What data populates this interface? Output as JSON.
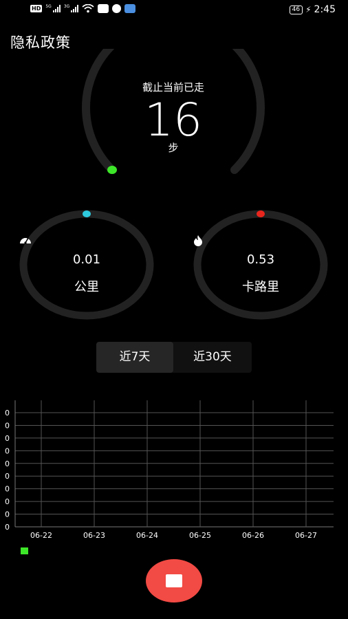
{
  "status_bar": {
    "hd_label": "HD",
    "net_label_1": "5G",
    "net_label_2": "3G",
    "battery_level": "46",
    "time": "2:45"
  },
  "page": {
    "title": "隐私政策"
  },
  "steps": {
    "caption": "截止当前已走",
    "value": "16",
    "unit": "步",
    "progress_fraction": 0.0,
    "indicator_color": "#3ee629"
  },
  "distance": {
    "icon": "speedometer-icon",
    "value": "0.01",
    "unit": "公里",
    "indicator_color": "#2ec9dd"
  },
  "calories": {
    "icon": "flame-icon",
    "value": "0.53",
    "unit": "卡路里",
    "indicator_color": "#e8261d"
  },
  "range_tabs": [
    {
      "label": "近7天",
      "active": true
    },
    {
      "label": "近30天",
      "active": false
    }
  ],
  "chart_data": {
    "type": "bar",
    "categories": [
      "06-22",
      "06-23",
      "06-24",
      "06-25",
      "06-26",
      "06-27"
    ],
    "series": [
      {
        "values": [
          0,
          0,
          0,
          0,
          0,
          0
        ],
        "color": "#3ee629"
      }
    ],
    "y_tick_labels": [
      "0",
      "0",
      "0",
      "0",
      "0",
      "0",
      "0",
      "0",
      "0",
      "0"
    ],
    "grid": true,
    "legend": "bottom-left"
  },
  "colors": {
    "background": "#000000",
    "ring_track": "#222222",
    "stop_button": "#f24a44"
  }
}
